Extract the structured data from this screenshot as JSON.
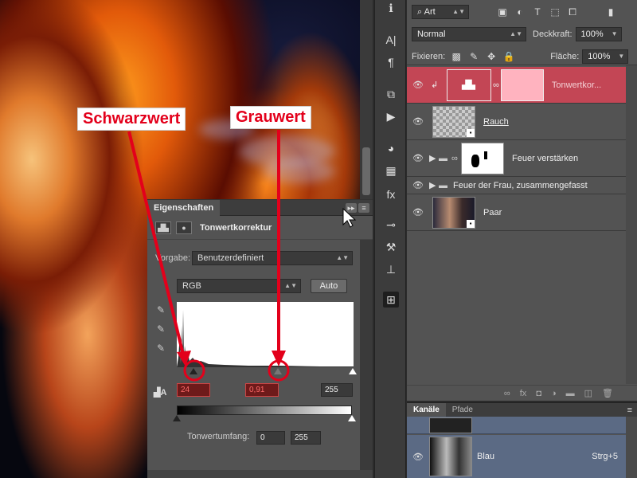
{
  "annotations": {
    "black_point": "Schwarzwert",
    "gray_point": "Grauwert"
  },
  "properties": {
    "tab_label": "Eigenschaften",
    "title": "Tonwertkorrektur",
    "preset_label": "Vorgabe:",
    "preset_value": "Benutzerdefiniert",
    "channel_value": "RGB",
    "auto_label": "Auto",
    "input_black": "24",
    "input_gray": "0,91",
    "input_white": "255",
    "output_label": "Tonwertumfang:",
    "output_black": "0",
    "output_white": "255"
  },
  "layers": {
    "kind_filter": "Art",
    "blend_mode": "Normal",
    "opacity_label": "Deckkraft:",
    "opacity_value": "100%",
    "lock_label": "Fixieren:",
    "fill_label": "Fläche:",
    "fill_value": "100%",
    "items": [
      {
        "name": "Tonwertkor..."
      },
      {
        "name": "Rauch"
      },
      {
        "name": "Feuer verstärken"
      },
      {
        "name": "Feuer der Frau, zusammengefasst"
      },
      {
        "name": "Paar"
      }
    ]
  },
  "channels": {
    "tabs": [
      "Kanäle",
      "Pfade"
    ],
    "rows": [
      {
        "name": "Blau",
        "shortcut": "Strg+5"
      }
    ]
  },
  "colors": {
    "accent_selected": "#c34655",
    "annotation_red": "#e3001b",
    "field_red": "#ff6b6b"
  }
}
